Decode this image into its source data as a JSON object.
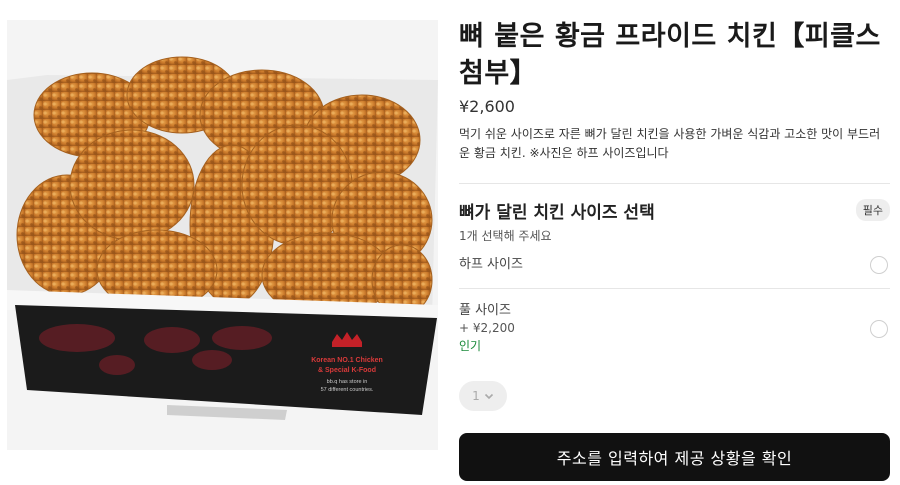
{
  "product": {
    "title": "뼈 붙은 황금 프라이드 치킨【피클스 첨부】",
    "price": "¥2,600",
    "description": "먹기 쉬운 사이즈로 자른 뼈가 달린 치킨을 사용한 가벼운 식감과 고소한 맛이 부드러운 황금 치킨. ※사진은 하프 사이즈입니다"
  },
  "box": {
    "line1": "Korean NO.1 Chicken",
    "line2": "& Special K-Food",
    "line3": "bb.q has store in",
    "line4": "57 different countries."
  },
  "options": {
    "title": "뼈가 달린 치킨 사이즈 선택",
    "required": "필수",
    "subtitle": "1개 선택해 주세요",
    "items": [
      {
        "label": "하프 사이즈"
      },
      {
        "label": "풀 사이즈",
        "extra": "+ ¥2,200",
        "tag": "인기"
      }
    ]
  },
  "quantity": {
    "value": "1"
  },
  "cta": {
    "label": "주소를 입력하여 제공 상황을 확인"
  }
}
